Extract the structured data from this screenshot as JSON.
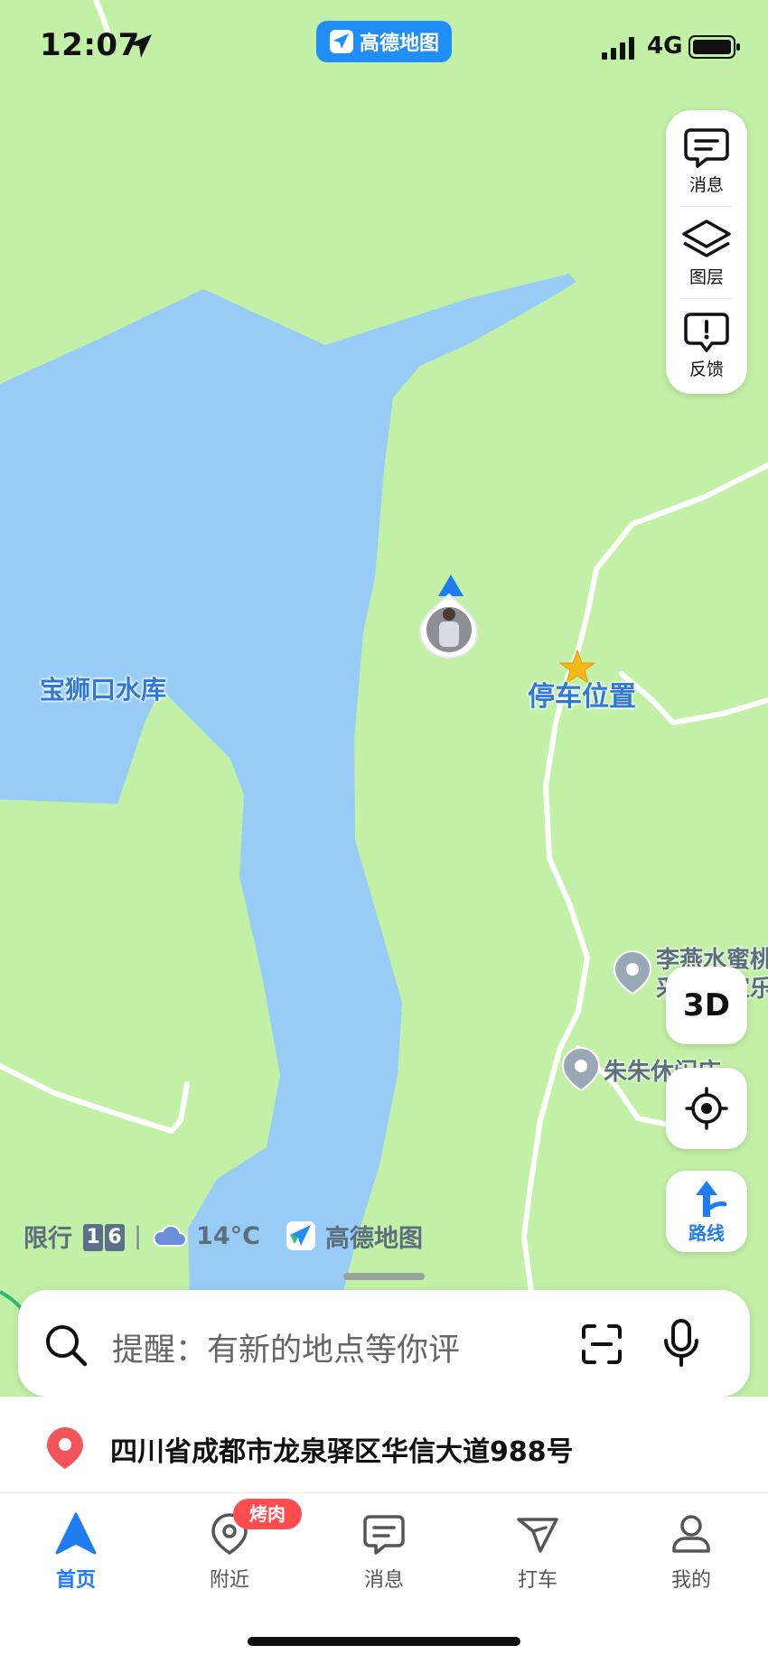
{
  "status_bar": {
    "time": "12:07",
    "app_name": "高德地图",
    "network": "4G"
  },
  "side_panel": {
    "items": [
      {
        "label": "消息",
        "icon": "message-icon"
      },
      {
        "label": "图层",
        "icon": "layers-icon"
      },
      {
        "label": "反馈",
        "icon": "feedback-icon"
      }
    ]
  },
  "map": {
    "labels": {
      "reservoir": "宝狮口水库",
      "parking": "停车位置",
      "poi1_line1": "李燕水蜜桃",
      "poi1_line2": "采摘农家乐",
      "poi2": "朱朱休闲庄"
    }
  },
  "info_row": {
    "restriction_label": "限行",
    "restriction_digits": [
      "1",
      "6"
    ],
    "divider": "|",
    "temperature": "14°C",
    "brand": "高德地图"
  },
  "controls": {
    "btn_3d": "3D",
    "route_label": "路线"
  },
  "search": {
    "placeholder": "提醒：有新的地点等你评"
  },
  "address": {
    "text": "四川省成都市龙泉驿区华信大道988号"
  },
  "tabs": [
    {
      "label": "首页",
      "active": true
    },
    {
      "label": "附近",
      "badge": "烤肉"
    },
    {
      "label": "消息"
    },
    {
      "label": "打车"
    },
    {
      "label": "我的"
    }
  ],
  "colors": {
    "land": "#c2f0a6",
    "water": "#98ccf7",
    "accent": "#1f7cf0",
    "badge": "#ff4d4f"
  }
}
